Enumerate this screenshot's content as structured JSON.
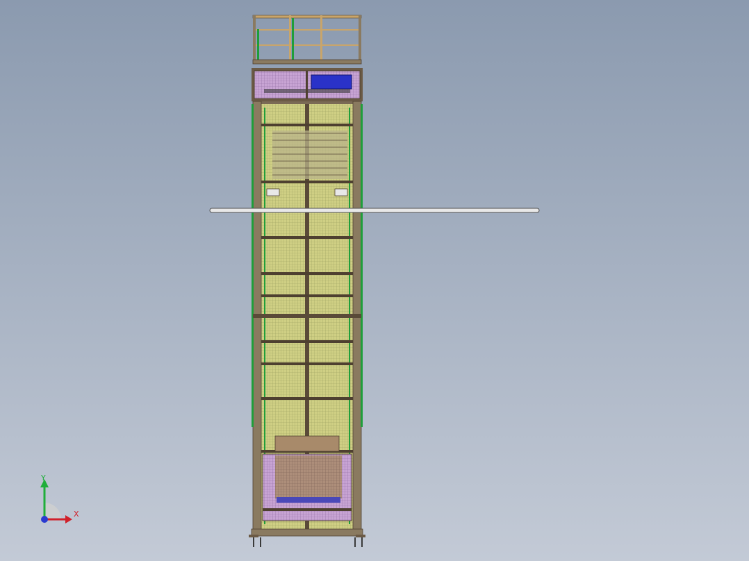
{
  "viewport": {
    "background_top": "#8b9aaf",
    "background_bottom": "#c3cad6"
  },
  "model": {
    "frame_color": "#6b5a45",
    "rail_color": "#c9a56a",
    "green_color": "#1f9e3a",
    "mesh_color": "#d8d27a",
    "panel_color": "#c6a0d8",
    "motor_color": "#2a32c8",
    "crossbar_color": "#e8e8e8"
  },
  "triad": {
    "x_label": "X",
    "y_label": "Y",
    "x_color": "#d0202a",
    "y_color": "#1fae3a",
    "z_color": "#2a3ad0"
  }
}
